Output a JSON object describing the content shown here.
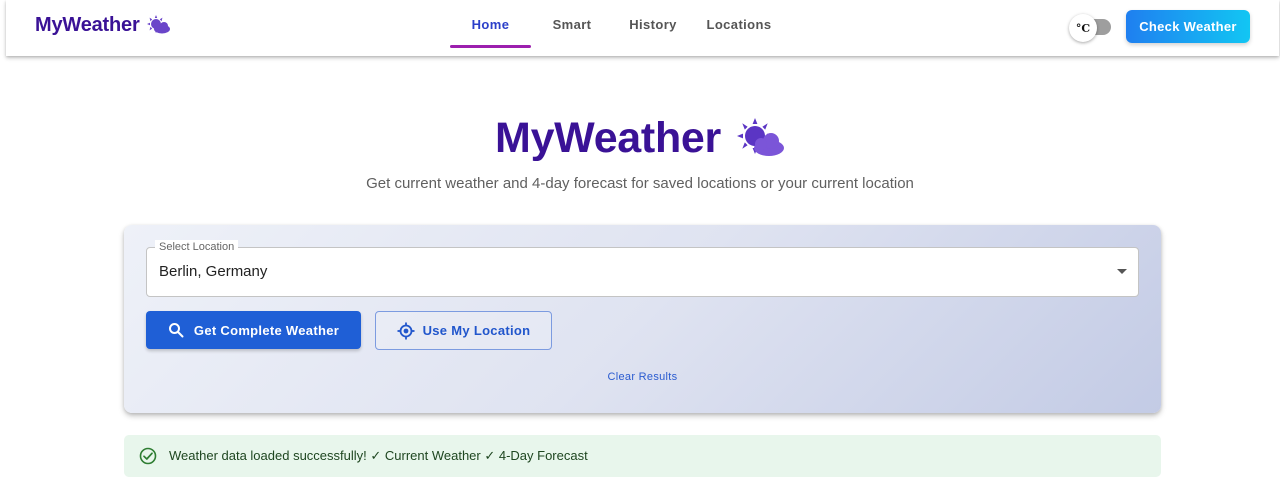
{
  "app": {
    "brand": "MyWeather",
    "colors": {
      "brand": "#3a1296",
      "primary": "#1f5fd6",
      "nav_active": "#2b3fc9",
      "nav_indicator": "#9c1fae",
      "success_bg": "#e8f6ec"
    }
  },
  "header": {
    "brand_icon": "sun-behind-cloud-icon",
    "nav": [
      {
        "label": "Home",
        "active": true
      },
      {
        "label": "Smart",
        "active": false
      },
      {
        "label": "History",
        "active": false
      },
      {
        "label": "Locations",
        "active": false
      }
    ],
    "unit_toggle": {
      "label": "°C",
      "state": "off"
    },
    "check_button": "Check Weather"
  },
  "hero": {
    "title": "MyWeather",
    "icon": "sun-behind-cloud-icon",
    "subtitle": "Get current weather and 4-day forecast for saved locations or your current location"
  },
  "form": {
    "select_label": "Select Location",
    "select_value": "Berlin, Germany",
    "get_button": "Get Complete Weather",
    "get_button_icon": "search-icon",
    "location_button": "Use My Location",
    "location_button_icon": "crosshair-icon",
    "clear_link": "Clear Results"
  },
  "alert": {
    "icon": "check-circle-icon",
    "message": "Weather data loaded successfully! ✓ Current Weather ✓ 4-Day Forecast"
  }
}
